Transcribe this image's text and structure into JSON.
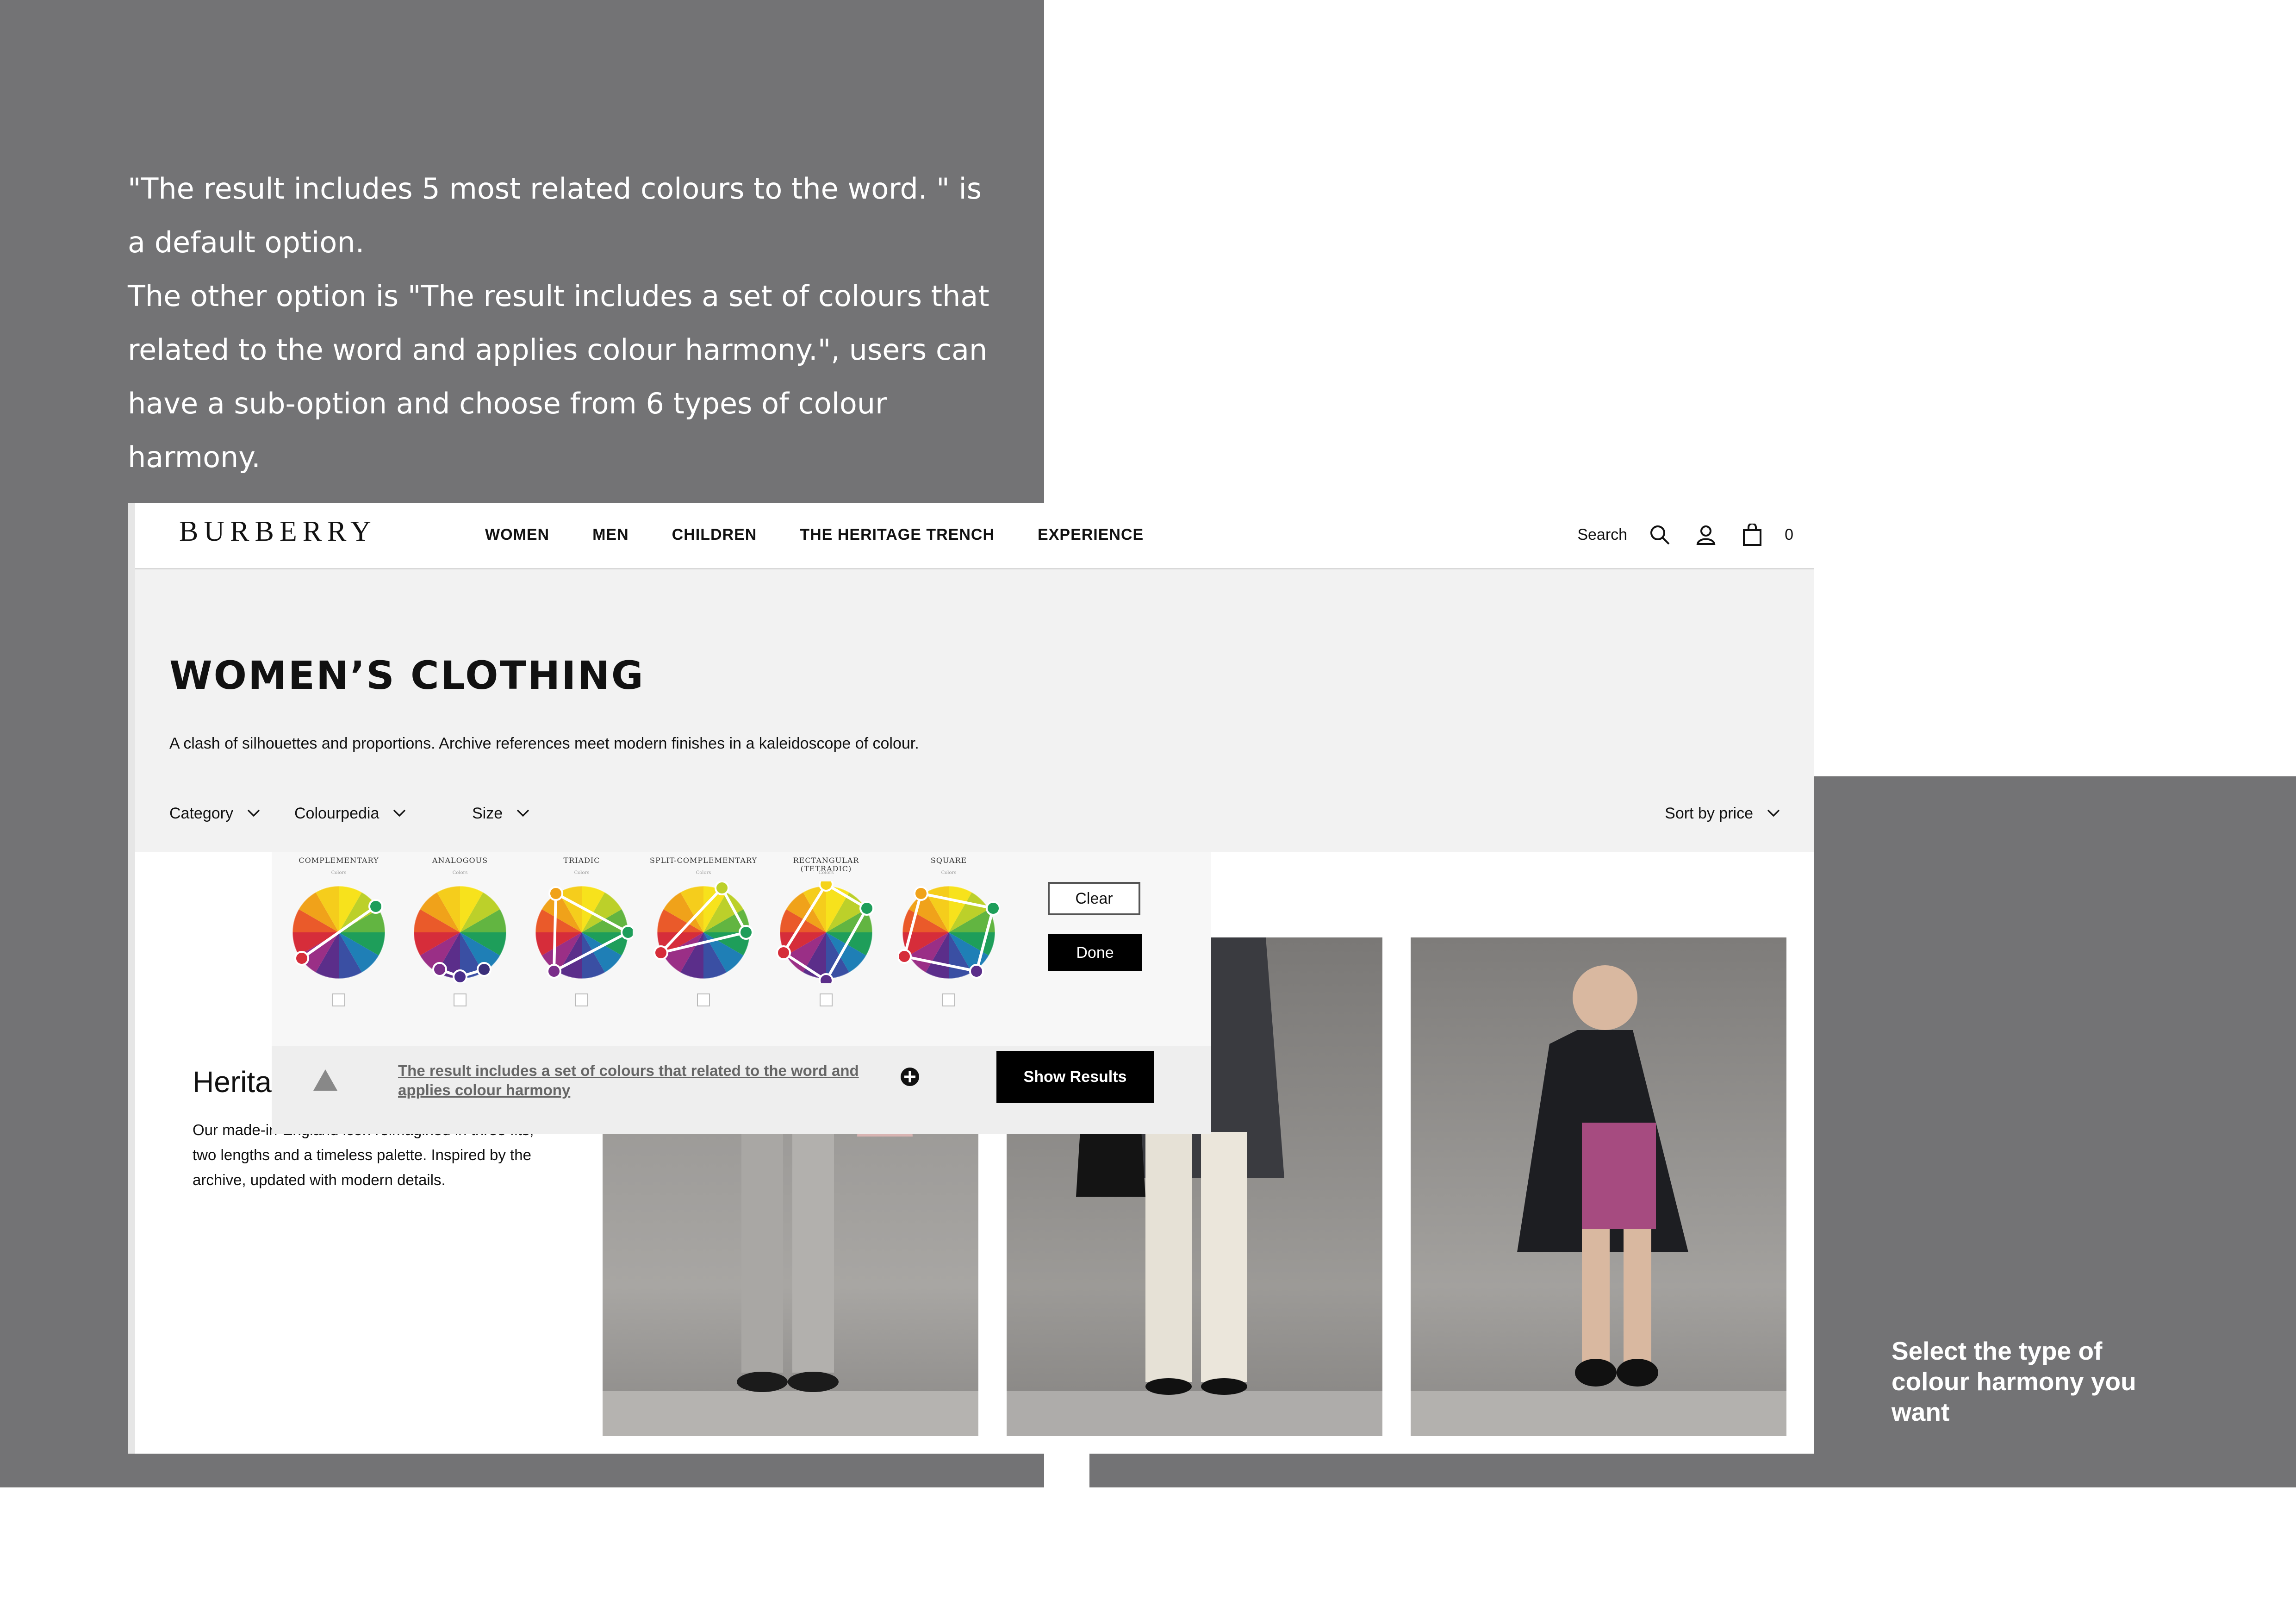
{
  "annotations": {
    "intro_lines": [
      "\"The result includes 5 most related colours to the word. \" is a default option.",
      "The other option is \"The result includes a set of colours that related to the word and applies colour harmony.\", users can have a sub-option and choose from 6 types of colour harmony."
    ],
    "side_note": "Select the type of colour harmony you want"
  },
  "header": {
    "logo": "BURBERRY",
    "nav": [
      "WOMEN",
      "MEN",
      "CHILDREN",
      "THE HERITAGE TRENCH",
      "EXPERIENCE"
    ],
    "search_label": "Search",
    "bag_count": "0"
  },
  "hero": {
    "title": "WOMEN’S CLOTHING",
    "description": "A clash of silhouettes and proportions. Archive references meet modern finishes in a kaleidoscope of colour."
  },
  "filters": {
    "category": "Category",
    "colourpedia": "Colourpedia",
    "size": "Size",
    "sort": "Sort by price"
  },
  "editorial": {
    "title": "Herita",
    "body": "Our made-in-England icon reimagined in three fits, two lengths and a timeless palette. Inspired by the archive, updated with modern details."
  },
  "harmony_panel": {
    "options": [
      {
        "name": "COMPLEMENTARY",
        "sub": "Colors",
        "checked": false
      },
      {
        "name": "ANALOGOUS",
        "sub": "Colors",
        "checked": false
      },
      {
        "name": "TRIADIC",
        "sub": "Colors",
        "checked": false
      },
      {
        "name": "SPLIT-COMPLEMENTARY",
        "sub": "Colors",
        "checked": false
      },
      {
        "name": "RECTANGULAR (TETRADIC)",
        "sub": "Colors",
        "checked": false
      },
      {
        "name": "SQUARE",
        "sub": "Colors",
        "checked": false
      }
    ],
    "clear_label": "Clear",
    "done_label": "Done",
    "result_option": "The result includes a set of colours that related to the word and applies colour harmony",
    "show_results_label": "Show Results"
  },
  "colors": {
    "annotation_bg": "#737375",
    "hero_bg": "#f2f2f2",
    "button_dark": "#000000"
  }
}
